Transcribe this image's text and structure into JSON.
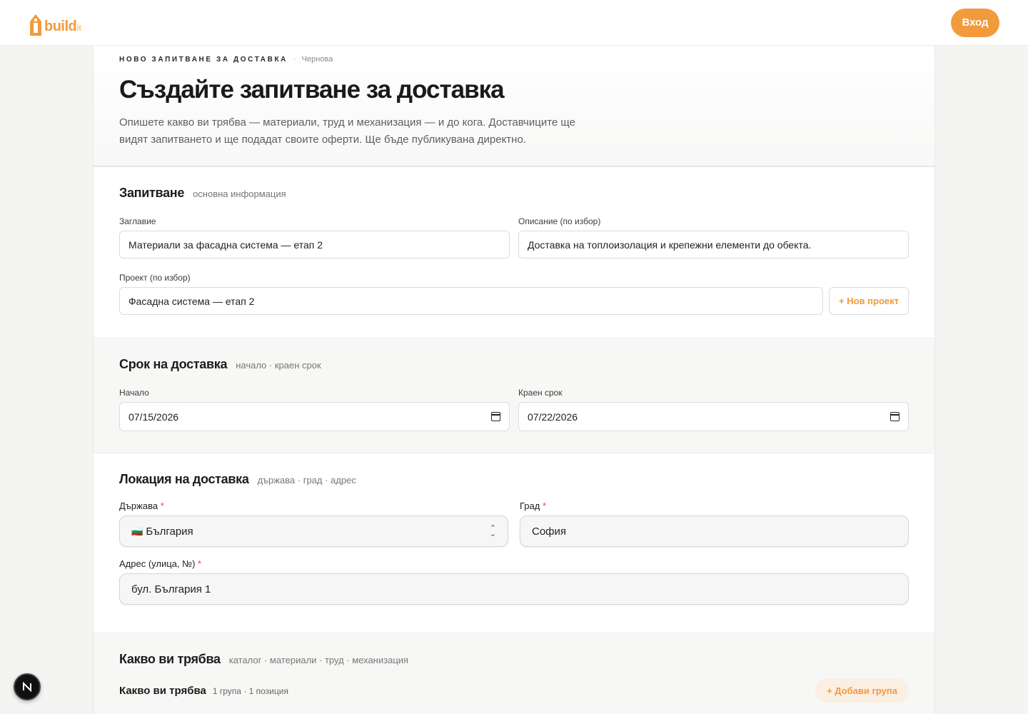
{
  "header": {
    "logo_text": "build",
    "logo_suffix": "it",
    "login_label": "Вход"
  },
  "hero": {
    "kicker": "НОВО ЗАПИТВАНЕ ЗА ДОСТАВКА",
    "separator": "·",
    "status": "Чернова",
    "title": "Създайте запитване за доставка",
    "description": "Опишете какво ви трябва — материали, труд и механизация — и до кога. Доставчиците ще видят запитването и ще подадат своите оферти. Ще бъде публикувана директно."
  },
  "request": {
    "title": "Запитване",
    "subtitle": "основна информация",
    "name_label": "Заглавие",
    "name_value": "Материали за фасадна система — етап 2",
    "description_label": "Описание (по избор)",
    "description_value": "Доставка на топлоизолация и крепежни елементи до обекта.",
    "project_label": "Проект (по избор)",
    "project_value": "Фасадна система — етап 2",
    "new_project_label": "+ Нов проект"
  },
  "schedule": {
    "title": "Срок на доставка",
    "subtitle": "начало · краен срок",
    "start_label": "Начало",
    "start_value": "07/15/2026",
    "end_label": "Краен срок",
    "end_value": "07/22/2026"
  },
  "location": {
    "title": "Локация на доставка",
    "subtitle": "държава · град · адрес",
    "country_label": "Държава",
    "country_flag": "🇧🇬",
    "country_value": "България",
    "city_label": "Град",
    "city_value": "София",
    "address_label": "Адрес (улица, №)",
    "address_value": "бул. България 1",
    "required_mark": "*"
  },
  "needs": {
    "title": "Какво ви трябва",
    "subtitle": "каталог · материали · труд · механизация",
    "group_title": "Какво ви трябва",
    "group_summary": "1 група · 1 позиция",
    "add_group_label": "+ Добави група"
  },
  "colors": {
    "accent": "#f29a3c",
    "required": "#e34b3c",
    "fab": "#111111"
  },
  "icons": {
    "calendar": "calendar-icon",
    "select": "chevron-updown-icon",
    "fab": "n-logo-icon"
  }
}
